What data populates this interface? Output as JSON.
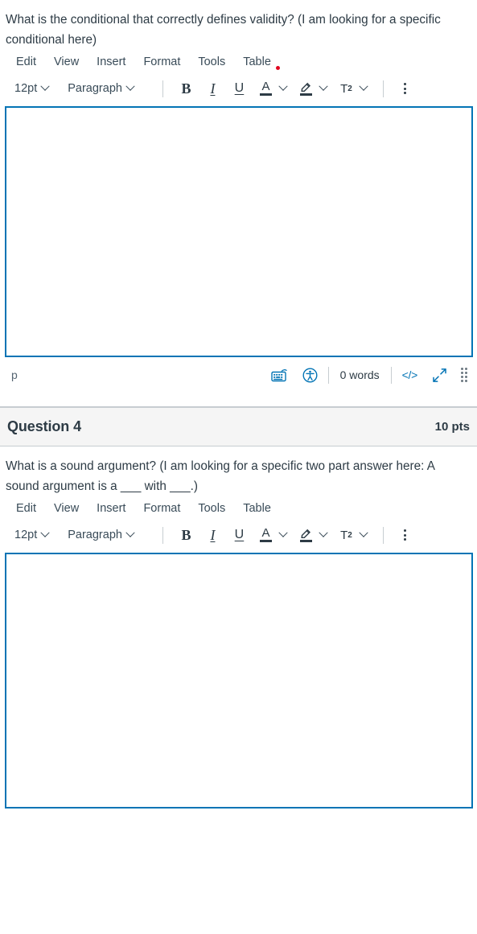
{
  "questions": [
    {
      "id": "q3",
      "show_header": false,
      "prompt": "What is the conditional that correctly defines validity? (I am looking for a specific conditional here)",
      "editor": {
        "menu": [
          "Edit",
          "View",
          "Insert",
          "Format",
          "Tools",
          "Table"
        ],
        "has_notification_dot": true,
        "font_size": "12pt",
        "block_format": "Paragraph",
        "buttons": {
          "bold": "B",
          "italic": "I",
          "underline": "U",
          "text_color": "A",
          "highlight": "highlighter",
          "superscript": "T",
          "superscript_exp": "2",
          "more": "more-options"
        },
        "content": "",
        "status": {
          "element_path": "p",
          "keyboard_icon": "keyboard-icon",
          "accessibility_icon": "accessibility-checker-icon",
          "word_count": "0 words",
          "html_editor": "</>",
          "fullscreen_icon": "expand-arrows-icon",
          "resize_handle": "resize-grip-icon"
        }
      }
    },
    {
      "id": "q4",
      "show_header": true,
      "header_title": "Question 4",
      "header_points": "10 pts",
      "prompt": "What is a sound argument? (I am looking for a specific two part answer here: A sound argument is a ___ with ___.)",
      "editor": {
        "menu": [
          "Edit",
          "View",
          "Insert",
          "Format",
          "Tools",
          "Table"
        ],
        "has_notification_dot": false,
        "font_size": "12pt",
        "block_format": "Paragraph",
        "buttons": {
          "bold": "B",
          "italic": "I",
          "underline": "U",
          "text_color": "A",
          "highlight": "highlighter",
          "superscript": "T",
          "superscript_exp": "2",
          "more": "more-options"
        },
        "content": ""
      }
    }
  ],
  "colors": {
    "accent_blue": "#0374B5",
    "text": "#2D3B45",
    "border_gray": "#C7CDD1",
    "header_band": "#F5F5F5",
    "notification_red": "#E0061F"
  }
}
